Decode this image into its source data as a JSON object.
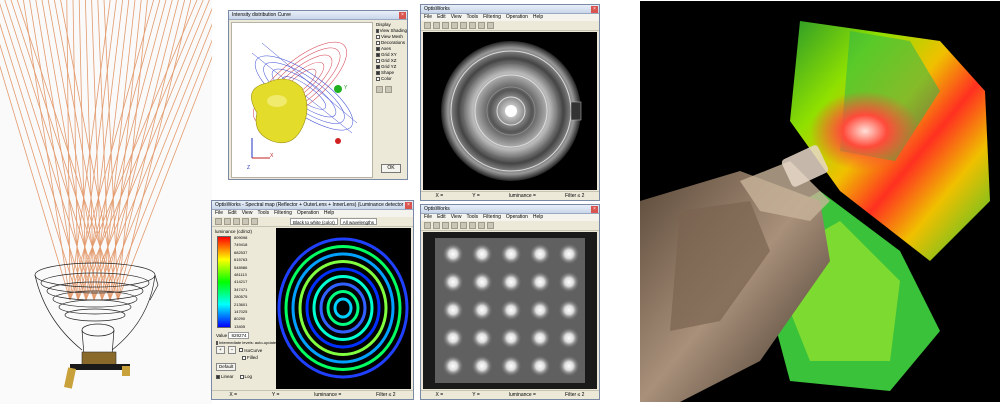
{
  "intensity_window": {
    "title": "Intensity distribution Curve",
    "display_heading": "Display",
    "options": [
      {
        "label": "View Shading",
        "checked": true
      },
      {
        "label": "View Mesh",
        "checked": false
      },
      {
        "label": "Decorations",
        "checked": false
      },
      {
        "label": "Axes",
        "checked": true
      },
      {
        "label": "Grid XY",
        "checked": true
      },
      {
        "label": "Grid XZ",
        "checked": false
      },
      {
        "label": "Grid YZ",
        "checked": true
      },
      {
        "label": "Shape",
        "checked": true
      },
      {
        "label": "Color",
        "checked": false
      }
    ],
    "ok_label": "OK",
    "axis_x": "X",
    "axis_y": "Y",
    "axis_z": "Z"
  },
  "optisworks_top": {
    "title": "OptisWorks",
    "menus": [
      "File",
      "Edit",
      "View",
      "Tools",
      "Filtering",
      "Operation",
      "Help"
    ],
    "status": [
      "X =",
      "Y =",
      "luminance =",
      "Filter ≤ 2"
    ]
  },
  "optisworks_spectral": {
    "title": "OptisWorks - Spectral map (Reflector + OuterLens + InnerLens) (Luminance detector 1)",
    "menus": [
      "File",
      "Edit",
      "View",
      "Tools",
      "Filtering",
      "Operation",
      "Help"
    ],
    "colormap": "Black to white (color)",
    "wavelengths": "All wavelengths",
    "legend_title": "luminance (cd/m2)",
    "scale_values": [
      "809098",
      "749418",
      "682537",
      "615763",
      "548986",
      "481113",
      "414217",
      "347471",
      "280575",
      "213601",
      "147025",
      "80290",
      "13405"
    ],
    "value_label": "Value",
    "value": "829274",
    "intermediate_label": "Intermediate levels: auto-update",
    "isocurve_label": "IsoCurve",
    "filled_label": "Filled",
    "default_label": "Default",
    "linear_label": "Linear",
    "log_label": "Log",
    "status": [
      "X =",
      "Y =",
      "luminance =",
      "Filter ≤ 2"
    ]
  },
  "optisworks_bottom": {
    "title": "OptisWorks",
    "menus": [
      "File",
      "Edit",
      "View",
      "Tools",
      "Filtering",
      "Operation",
      "Help"
    ],
    "status": [
      "X =",
      "Y =",
      "luminance =",
      "Filter ≤ 2"
    ]
  }
}
